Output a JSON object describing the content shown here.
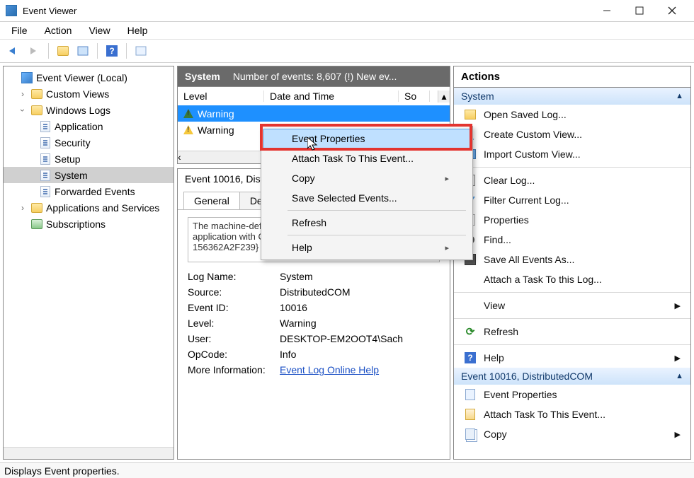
{
  "window": {
    "title": "Event Viewer"
  },
  "menu": {
    "file": "File",
    "action": "Action",
    "view": "View",
    "help": "Help"
  },
  "tree": {
    "root": "Event Viewer (Local)",
    "custom_views": "Custom Views",
    "windows_logs": "Windows Logs",
    "logs": {
      "application": "Application",
      "security": "Security",
      "setup": "Setup",
      "system": "System",
      "forwarded": "Forwarded Events"
    },
    "apps_services": "Applications and Services",
    "subscriptions": "Subscriptions"
  },
  "center": {
    "header_title": "System",
    "header_sub": "Number of events: 8,607 (!) New ev...",
    "columns": {
      "level": "Level",
      "date": "Date and Time",
      "source": "So"
    },
    "rows": [
      {
        "level": "Warning"
      },
      {
        "level": "Warning"
      }
    ],
    "detail_title": "Event 10016, Dist",
    "tabs": {
      "general": "General",
      "details": "Deta"
    },
    "description": "The machine-default permission settings do COM Server application with CLSID {C2F03A33-21F5-47FA-B4BB-156362A2F239}",
    "fields": {
      "log_name_lbl": "Log Name:",
      "log_name": "System",
      "source_lbl": "Source:",
      "source": "DistributedCOM",
      "event_id_lbl": "Event ID:",
      "event_id": "10016",
      "level_lbl": "Level:",
      "level": "Warning",
      "user_lbl": "User:",
      "user": "DESKTOP-EM2OOT4\\Sach",
      "opcode_lbl": "OpCode:",
      "opcode": "Info",
      "more_lbl": "More Information:",
      "more_link": "Event Log Online Help"
    }
  },
  "actions": {
    "header": "Actions",
    "section1": "System",
    "items1": [
      "Open Saved Log...",
      "Create Custom View...",
      "Import Custom View...",
      "Clear Log...",
      "Filter Current Log...",
      "Properties",
      "Find...",
      "Save All Events As...",
      "Attach a Task To this Log..."
    ],
    "view": "View",
    "refresh": "Refresh",
    "help": "Help",
    "section2": "Event 10016, DistributedCOM",
    "items2": [
      "Event Properties",
      "Attach Task To This Event...",
      "Copy"
    ]
  },
  "context": {
    "event_properties": "Event Properties",
    "attach_task": "Attach Task To This Event...",
    "copy": "Copy",
    "save_selected": "Save Selected Events...",
    "refresh": "Refresh",
    "help": "Help"
  },
  "status": "Displays Event properties."
}
